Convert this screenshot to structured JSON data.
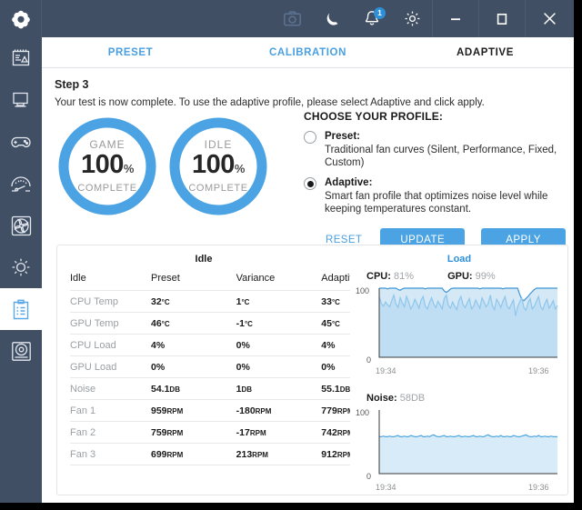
{
  "titlebar": {
    "logo": "app-logo",
    "icons": [
      {
        "name": "screenshot-icon",
        "label": "Screenshot"
      },
      {
        "name": "moon-icon",
        "label": "Night mode"
      },
      {
        "name": "bell-icon",
        "label": "Notifications",
        "badge": "1"
      },
      {
        "name": "gear-icon",
        "label": "Settings"
      }
    ],
    "window": [
      {
        "name": "minimize-button",
        "label": "Minimize"
      },
      {
        "name": "maximize-button",
        "label": "Maximize"
      },
      {
        "name": "close-button",
        "label": "Close"
      }
    ]
  },
  "sidebar": {
    "items": [
      {
        "name": "sidebar-item-report",
        "icon": "report-icon",
        "active": false
      },
      {
        "name": "sidebar-item-desktop",
        "icon": "monitor-icon",
        "active": false
      },
      {
        "name": "sidebar-item-gaming",
        "icon": "gamepad-icon",
        "active": false
      },
      {
        "name": "sidebar-item-performance",
        "icon": "speedometer-icon",
        "active": false
      },
      {
        "name": "sidebar-item-cooling",
        "icon": "fan-icon",
        "active": false
      },
      {
        "name": "sidebar-item-lighting",
        "icon": "brightness-icon",
        "active": false
      },
      {
        "name": "sidebar-item-tuning",
        "icon": "clipboard-icon",
        "active": true
      },
      {
        "name": "sidebar-item-storage",
        "icon": "drive-icon",
        "active": false
      }
    ]
  },
  "tabs": [
    {
      "label": "PRESET",
      "active": false
    },
    {
      "label": "CALIBRATION",
      "active": false
    },
    {
      "label": "ADAPTIVE",
      "active": true
    }
  ],
  "step": {
    "title": "Step 3",
    "description": "Your test is now complete. To use the adaptive profile, please select Adaptive and click apply."
  },
  "gauges": [
    {
      "name": "gauge-game",
      "label": "GAME",
      "value": "100",
      "unit": "%",
      "sub": "COMPLETE",
      "percent": 100
    },
    {
      "name": "gauge-idle",
      "label": "IDLE",
      "value": "100",
      "unit": "%",
      "sub": "COMPLETE",
      "percent": 100
    }
  ],
  "profile": {
    "title": "CHOOSE YOUR PROFILE:",
    "options": [
      {
        "label": "Preset:",
        "description": "Traditional fan curves (Silent, Performance, Fixed, Custom)",
        "selected": false
      },
      {
        "label": "Adaptive:",
        "description": "Smart fan profile that optimizes noise level while keeping temperatures constant.",
        "selected": true
      }
    ],
    "buttons": {
      "reset": "RESET",
      "update": "UPDATE",
      "apply": "APPLY"
    }
  },
  "table": {
    "title": "Idle",
    "columns": [
      "Idle",
      "Preset",
      "Variance",
      "Adaptive"
    ],
    "rows": [
      {
        "label": "CPU Temp",
        "preset": "32",
        "preset_unit": "°C",
        "variance": "1",
        "variance_unit": "°C",
        "adaptive": "33",
        "adaptive_unit": "°C",
        "adaptive_green": false
      },
      {
        "label": "GPU Temp",
        "preset": "46",
        "preset_unit": "°C",
        "variance": "-1",
        "variance_unit": "°C",
        "adaptive": "45",
        "adaptive_unit": "°C",
        "adaptive_green": true
      },
      {
        "label": "CPU Load",
        "preset": "4%",
        "preset_unit": "",
        "variance": "0%",
        "variance_unit": "",
        "adaptive": "4%",
        "adaptive_unit": "",
        "adaptive_green": false
      },
      {
        "label": "GPU Load",
        "preset": "0%",
        "preset_unit": "",
        "variance": "0%",
        "variance_unit": "",
        "adaptive": "0%",
        "adaptive_unit": "",
        "adaptive_green": true
      },
      {
        "label": "Noise",
        "preset": "54.1",
        "preset_unit": "DB",
        "variance": "1",
        "variance_unit": "DB",
        "adaptive": "55.1",
        "adaptive_unit": "DB",
        "adaptive_green": false
      },
      {
        "label": "Fan 1",
        "preset": "959",
        "preset_unit": "RPM",
        "variance": "-180",
        "variance_unit": "RPM",
        "adaptive": "779",
        "adaptive_unit": "RPM",
        "adaptive_green": true
      },
      {
        "label": "Fan 2",
        "preset": "759",
        "preset_unit": "RPM",
        "variance": "-17",
        "variance_unit": "RPM",
        "adaptive": "742",
        "adaptive_unit": "RPM",
        "adaptive_green": true
      },
      {
        "label": "Fan 3",
        "preset": "699",
        "preset_unit": "RPM",
        "variance": "213",
        "variance_unit": "RPM",
        "adaptive": "912",
        "adaptive_unit": "RPM",
        "adaptive_green": false
      }
    ]
  },
  "colors": {
    "accent": "#4ba3e3",
    "chrome": "#414f64",
    "green": "#5c9a21",
    "muted": "#9a9fa5"
  },
  "chart_data": [
    {
      "type": "area",
      "name": "load-chart",
      "title": "Load",
      "legend": [
        {
          "name": "CPU",
          "value": "81%"
        },
        {
          "name": "GPU",
          "value": "99%"
        }
      ],
      "ylabel": "",
      "xlabel": "",
      "ylim": [
        0,
        100
      ],
      "yticks": [
        "0",
        "100"
      ],
      "xticks": [
        "19:34",
        "19:36"
      ],
      "grid": false,
      "legend_position": "top",
      "series": [
        {
          "name": "GPU",
          "color": "#3f96d6",
          "values": [
            100,
            100,
            100,
            100,
            99,
            100,
            100,
            100,
            100,
            98,
            97,
            99,
            100,
            100,
            100,
            100,
            100,
            100,
            100,
            100,
            100,
            100,
            99,
            100,
            100,
            100,
            100,
            100,
            100,
            100,
            100,
            96,
            94,
            96,
            99,
            100,
            100,
            100,
            100,
            100,
            100,
            100,
            100,
            100,
            100,
            100,
            100,
            100,
            99,
            100,
            100,
            100,
            100,
            100,
            100,
            100,
            100,
            100,
            100,
            99,
            100,
            100,
            100,
            100,
            100,
            100,
            100,
            91,
            84,
            82,
            85,
            88,
            92,
            95,
            98,
            100,
            100,
            100,
            100,
            100,
            100,
            100,
            100,
            100,
            100,
            100
          ]
        },
        {
          "name": "CPU",
          "color": "#8ec6ec",
          "values": [
            88,
            78,
            74,
            80,
            76,
            73,
            82,
            90,
            77,
            72,
            86,
            79,
            73,
            88,
            81,
            70,
            75,
            84,
            78,
            71,
            83,
            88,
            74,
            70,
            79,
            86,
            77,
            72,
            81,
            76,
            70,
            85,
            90,
            75,
            71,
            80,
            74,
            69,
            82,
            88,
            76,
            72,
            79,
            85,
            70,
            74,
            83,
            77,
            71,
            86,
            80,
            73,
            78,
            90,
            75,
            69,
            84,
            79,
            72,
            81,
            88,
            74,
            70,
            77,
            83,
            60,
            73,
            80,
            86,
            72,
            68,
            79,
            85,
            70,
            74,
            81,
            88,
            73,
            69,
            78,
            84,
            71,
            76,
            82,
            70,
            75
          ]
        }
      ]
    },
    {
      "type": "area",
      "name": "noise-chart",
      "title": "",
      "legend": [
        {
          "name": "Noise",
          "value": "58DB"
        }
      ],
      "ylabel": "",
      "xlabel": "",
      "ylim": [
        0,
        100
      ],
      "yticks": [
        "0",
        "100"
      ],
      "xticks": [
        "19:34",
        "19:36"
      ],
      "grid": false,
      "legend_position": "top",
      "series": [
        {
          "name": "Noise",
          "color": "#4ea6df",
          "values": [
            58,
            58,
            59,
            58,
            58,
            59,
            58,
            58,
            59,
            60,
            58,
            58,
            59,
            58,
            58,
            60,
            59,
            58,
            58,
            59,
            60,
            58,
            58,
            59,
            58,
            60,
            61,
            59,
            58,
            58,
            59,
            60,
            58,
            58,
            59,
            58,
            58,
            59,
            60,
            58,
            58,
            59,
            58,
            58,
            59,
            60,
            58,
            58,
            59,
            58,
            58,
            60,
            61,
            59,
            58,
            58,
            59,
            58,
            60,
            58,
            58,
            59,
            58,
            58,
            60,
            59,
            58,
            58,
            59,
            60,
            61,
            59,
            58,
            58,
            59,
            58,
            60,
            58,
            58,
            59,
            58,
            58,
            59,
            58,
            58,
            58
          ]
        }
      ]
    }
  ]
}
